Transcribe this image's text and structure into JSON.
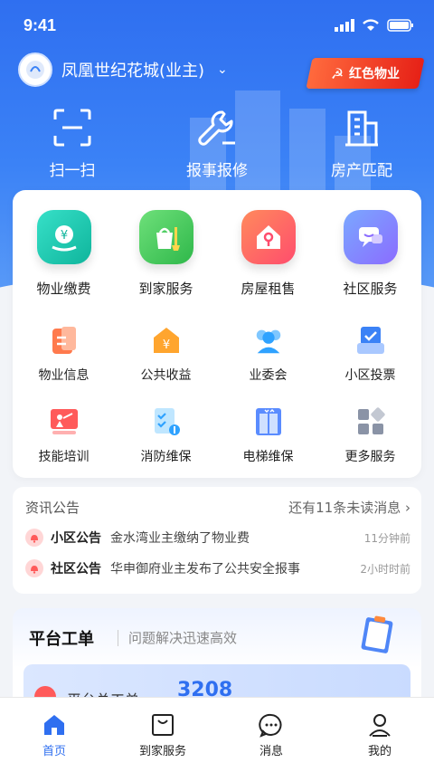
{
  "status_bar": {
    "time": "9:41"
  },
  "header": {
    "community": "凤凰世纪花城(业主)",
    "badge": "红色物业"
  },
  "quick_actions": [
    {
      "label": "扫一扫",
      "icon": "scan-icon"
    },
    {
      "label": "报事报修",
      "icon": "wrench-icon"
    },
    {
      "label": "房产匹配",
      "icon": "building-icon"
    }
  ],
  "services_big": [
    {
      "label": "物业缴费",
      "icon": "payment-icon"
    },
    {
      "label": "到家服务",
      "icon": "cleaning-icon"
    },
    {
      "label": "房屋租售",
      "icon": "house-key-icon"
    },
    {
      "label": "社区服务",
      "icon": "chat-icon"
    }
  ],
  "services_row2": [
    {
      "label": "物业信息",
      "icon": "document-icon"
    },
    {
      "label": "公共收益",
      "icon": "yuan-house-icon"
    },
    {
      "label": "业委会",
      "icon": "people-icon"
    },
    {
      "label": "小区投票",
      "icon": "vote-icon"
    }
  ],
  "services_row3": [
    {
      "label": "技能培训",
      "icon": "training-icon"
    },
    {
      "label": "消防维保",
      "icon": "fire-check-icon"
    },
    {
      "label": "电梯维保",
      "icon": "elevator-icon"
    },
    {
      "label": "更多服务",
      "icon": "more-grid-icon"
    }
  ],
  "news": {
    "title": "资讯公告",
    "more": "还有11条未读消息",
    "items": [
      {
        "tag": "小区公告",
        "text": "金水湾业主缴纳了物业费",
        "time": "11分钟前"
      },
      {
        "tag": "社区公告",
        "text": "华申御府业主发布了公共安全报事",
        "time": "2小时时前"
      }
    ]
  },
  "work_order": {
    "title": "平台工单",
    "subtitle": "问题解决迅速高效",
    "banner_text": "平台总工单",
    "banner_value": "3208"
  },
  "tabbar": [
    {
      "label": "首页",
      "icon": "home-icon",
      "active": true
    },
    {
      "label": "到家服务",
      "icon": "bag-icon",
      "active": false
    },
    {
      "label": "消息",
      "icon": "message-icon",
      "active": false
    },
    {
      "label": "我的",
      "icon": "user-icon",
      "active": false
    }
  ],
  "colors": {
    "primary": "#2f6ff0",
    "badge_red": "#e62117"
  }
}
